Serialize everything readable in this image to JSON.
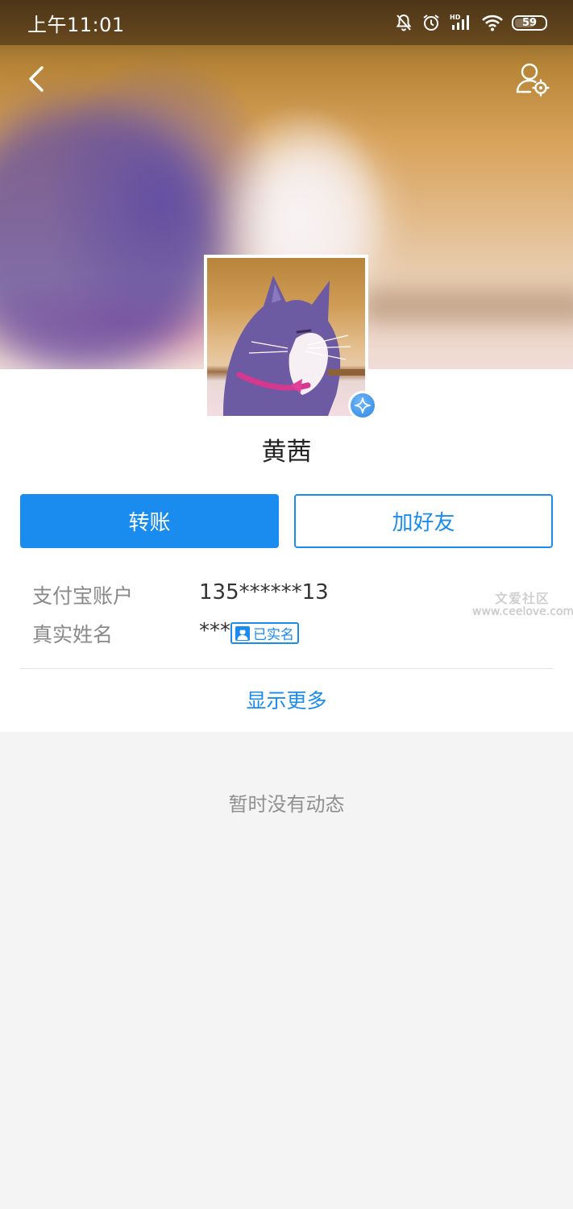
{
  "status_bar": {
    "time": "上午11:01",
    "icons": [
      "mute-icon",
      "alarm-icon",
      "hd-signal-icon",
      "wifi-icon",
      "battery-icon"
    ],
    "signal_label": "HD",
    "battery_level": "59"
  },
  "nav": {
    "back_icon": "chevron-left-icon",
    "settings_icon": "user-settings-icon"
  },
  "profile": {
    "name": "黄茜",
    "badge_icon": "vip-star-icon"
  },
  "actions": {
    "transfer_label": "转账",
    "add_friend_label": "加好友"
  },
  "info": {
    "account_label": "支付宝账户",
    "account_value": "135******13",
    "realname_label": "真实姓名",
    "realname_value": "***",
    "verified_label": "已实名"
  },
  "watermark": {
    "title": "文爱社区",
    "url": "www.ceelove.com"
  },
  "show_more_label": "显示更多",
  "feed": {
    "empty_text": "暂时没有动态"
  },
  "colors": {
    "accent": "#1a8cef",
    "background": "#f4f4f4",
    "label_gray": "#8a8a8a"
  }
}
